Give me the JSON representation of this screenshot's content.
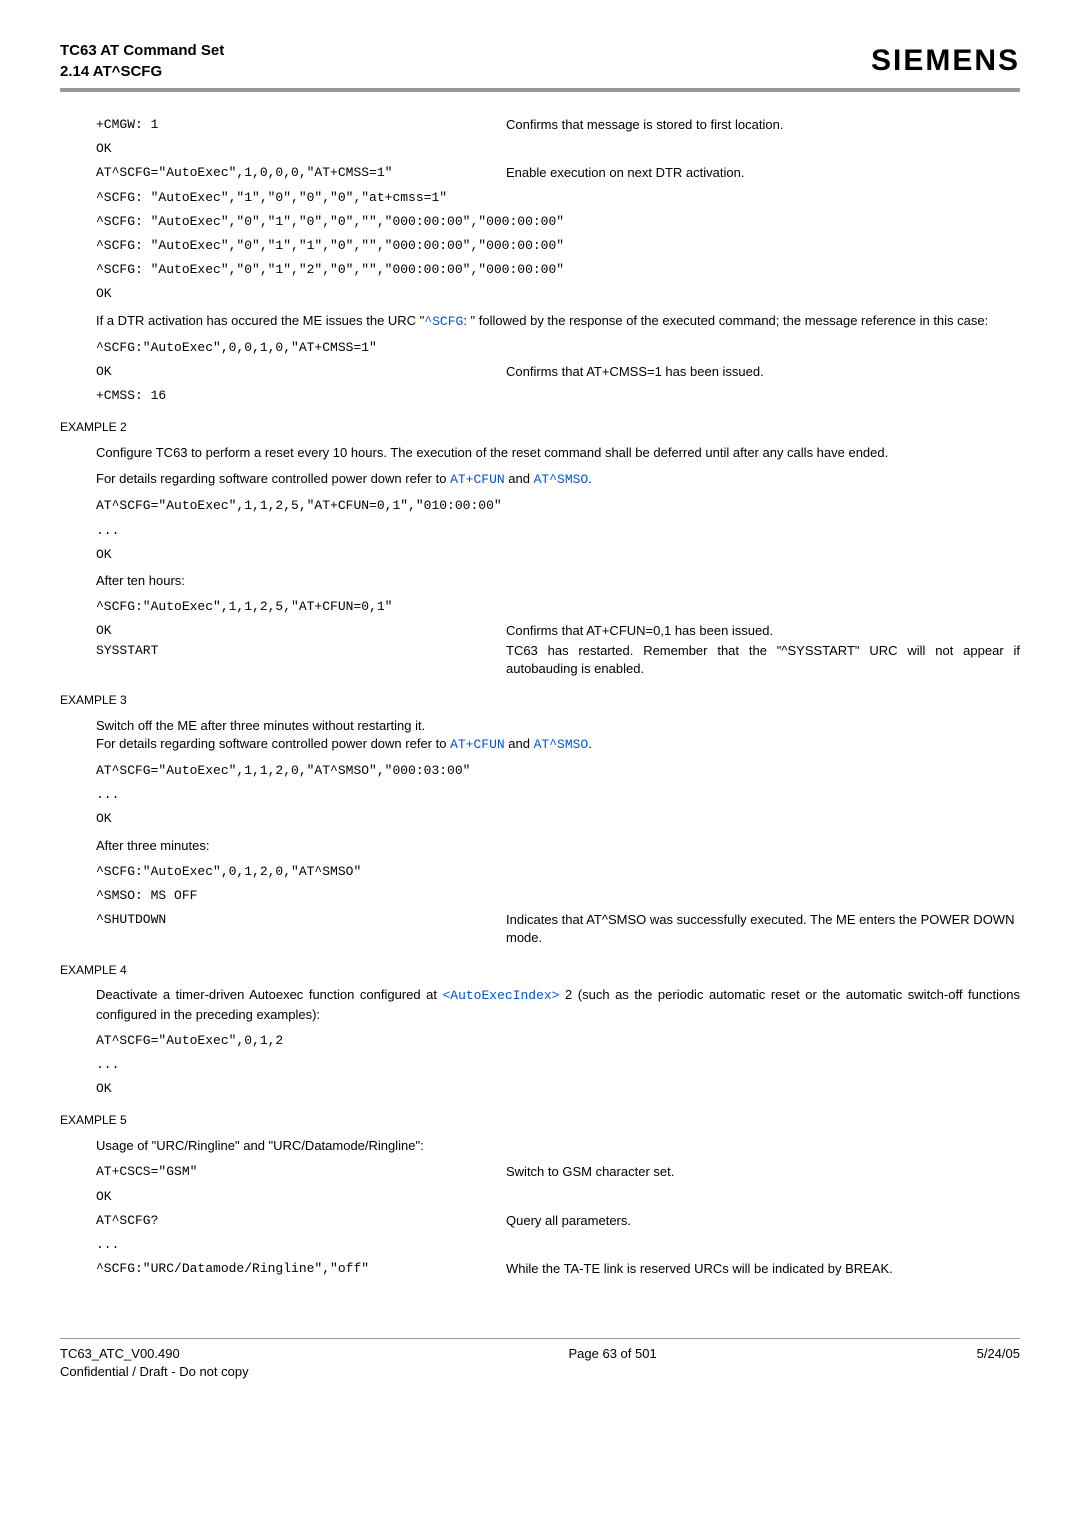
{
  "header": {
    "title_line1": "TC63 AT Command Set",
    "title_line2": "2.14 AT^SCFG",
    "brand": "SIEMENS"
  },
  "block1": {
    "l1_code": "+CMGW: 1",
    "l1_desc": "Confirms that message is stored to first location.",
    "l2": "OK",
    "l3_code": "AT^SCFG=\"AutoExec\",1,0,0,0,\"AT+CMSS=1\"",
    "l3_desc": "Enable execution on next DTR activation.",
    "l4": "^SCFG: \"AutoExec\",\"1\",\"0\",\"0\",\"0\",\"at+cmss=1\"",
    "l5": "^SCFG: \"AutoExec\",\"0\",\"1\",\"0\",\"0\",\"\",\"000:00:00\",\"000:00:00\"",
    "l6": "^SCFG: \"AutoExec\",\"0\",\"1\",\"1\",\"0\",\"\",\"000:00:00\",\"000:00:00\"",
    "l7": "^SCFG: \"AutoExec\",\"0\",\"1\",\"2\",\"0\",\"\",\"000:00:00\",\"000:00:00\"",
    "l8": "OK"
  },
  "para1_a": "If a DTR activation has occured the ME issues the URC \"",
  "para1_link": "^SCFG",
  "para1_b": ": \" followed by the response of the executed command; the message reference in this case:",
  "block2": {
    "l1": "^SCFG:\"AutoExec\",0,0,1,0,\"AT+CMSS=1\"",
    "l2_code": "OK",
    "l2_desc": "Confirms that AT+CMSS=1 has been issued.",
    "l3": "+CMSS: 16"
  },
  "ex2_label": "EXAMPLE 2",
  "ex2_p1": "Configure TC63 to perform a reset every 10 hours. The execution of the reset command shall be deferred until after any calls have ended.",
  "ex2_p2_a": "For details regarding software controlled power down refer to ",
  "ex2_p2_l1": "AT+CFUN",
  "ex2_p2_mid": " and ",
  "ex2_p2_l2": "AT^SMSO",
  "ex2_p2_end": ".",
  "block3": {
    "l1": "AT^SCFG=\"AutoExec\",1,1,2,5,\"AT+CFUN=0,1\",\"010:00:00\"",
    "l2": "...",
    "l3": "OK"
  },
  "ex2_after": "After ten hours:",
  "block4": {
    "l1": "^SCFG:\"AutoExec\",1,1,2,5,\"AT+CFUN=0,1\"",
    "l2_code": "OK",
    "l2_desc": "Confirms that AT+CFUN=0,1 has been issued.",
    "l3_code": "SYSSTART",
    "l3_desc": "TC63 has restarted. Remember that the \"^SYSSTART\" URC will not appear if autobauding is enabled."
  },
  "ex3_label": "EXAMPLE 3",
  "ex3_p1": "Switch off the ME after three minutes without restarting it.",
  "ex3_p2_a": "For details regarding software controlled power down refer to ",
  "ex3_p2_l1": "AT+CFUN",
  "ex3_p2_mid": " and ",
  "ex3_p2_l2": "AT^SMSO",
  "ex3_p2_end": ".",
  "block5": {
    "l1": "AT^SCFG=\"AutoExec\",1,1,2,0,\"AT^SMSO\",\"000:03:00\"",
    "l2": "...",
    "l3": "OK"
  },
  "ex3_after": "After three minutes:",
  "block6": {
    "l1": "^SCFG:\"AutoExec\",0,1,2,0,\"AT^SMSO\"",
    "l2": "^SMSO: MS OFF",
    "l3_code": "^SHUTDOWN",
    "l3_desc": "Indicates that AT^SMSO was successfully executed. The ME enters the POWER DOWN mode."
  },
  "ex4_label": "EXAMPLE 4",
  "ex4_p_a": "Deactivate a timer-driven Autoexec function configured at ",
  "ex4_p_link": "<AutoExecIndex>",
  "ex4_p_b": " 2 (such as the periodic automatic reset or the automatic switch-off functions configured in the preceding examples):",
  "block7": {
    "l1": "AT^SCFG=\"AutoExec\",0,1,2",
    "l2": "...",
    "l3": "OK"
  },
  "ex5_label": "EXAMPLE 5",
  "ex5_p": "Usage of \"URC/Ringline\" and \"URC/Datamode/Ringline\":",
  "block8": {
    "l1_code": "AT+CSCS=\"GSM\"",
    "l1_desc": "Switch to GSM character set.",
    "l2": "OK",
    "l3_code": "AT^SCFG?",
    "l3_desc": "Query all parameters.",
    "l4": "...",
    "l5_code": "^SCFG:\"URC/Datamode/Ringline\",\"off\"",
    "l5_desc": "While the TA-TE link is reserved URCs will be indicated by BREAK."
  },
  "footer": {
    "left_l1": "TC63_ATC_V00.490",
    "left_l2": "Confidential / Draft - Do not copy",
    "center": "Page 63 of 501",
    "right": "5/24/05"
  }
}
